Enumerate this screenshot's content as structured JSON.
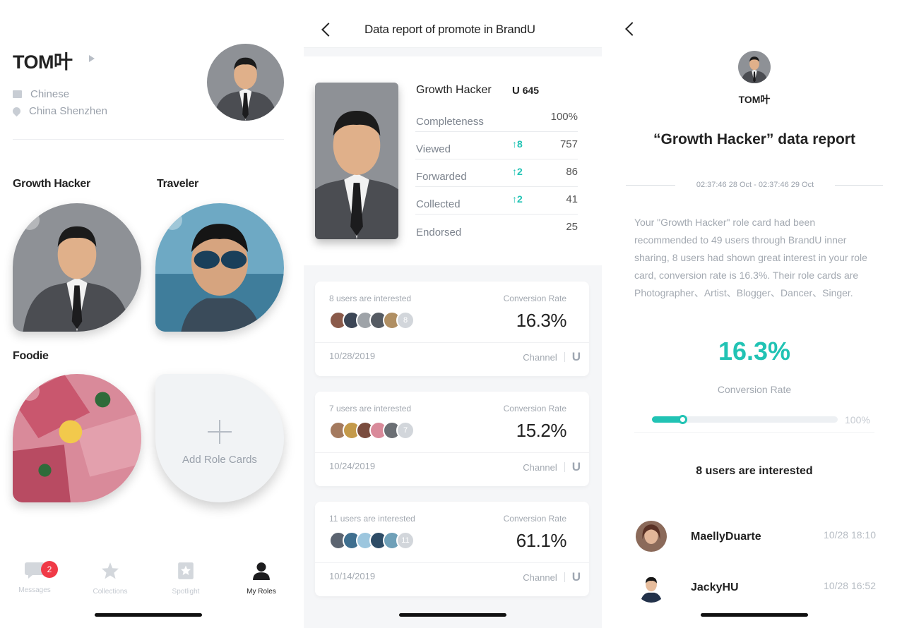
{
  "profile": {
    "name": "TOM叶",
    "language": "Chinese",
    "location": "China Shenzhen"
  },
  "roles": [
    {
      "title": "Growth Hacker",
      "menu": "···"
    },
    {
      "title": "Traveler",
      "menu": "···"
    },
    {
      "title": "Foodie",
      "menu": "···"
    }
  ],
  "add_card_label": "Add Role Cards",
  "tabbar": {
    "messages": "Messages",
    "messages_badge": "2",
    "collections": "Collections",
    "spotlight": "Spotlight",
    "my_roles": "My Roles"
  },
  "report": {
    "header_title": "Data report of promote in BrandU",
    "role": "Growth Hacker",
    "u_score": "645",
    "stats": [
      {
        "label": "Completeness",
        "delta": "",
        "value": "100%"
      },
      {
        "label": "Viewed",
        "delta": "↑8",
        "value": "757"
      },
      {
        "label": "Forwarded",
        "delta": "↑2",
        "value": "86"
      },
      {
        "label": "Collected",
        "delta": "↑2",
        "value": "41"
      },
      {
        "label": "Endorsed",
        "delta": "",
        "value": "25"
      }
    ],
    "conversion_label": "Conversion Rate",
    "channel_label": "Channel",
    "cards": [
      {
        "interest": "8 users are interested",
        "rate": "16.3%",
        "date": "10/28/2019",
        "count": "8"
      },
      {
        "interest": "7 users are interested",
        "rate": "15.2%",
        "date": "10/24/2019",
        "count": "7"
      },
      {
        "interest": "11 users are interested",
        "rate": "61.1%",
        "date": "10/14/2019",
        "count": "11"
      }
    ]
  },
  "detail": {
    "user": "TOM叶",
    "title": "“Growth Hacker” data report",
    "range": "02:37:46 28 Oct - 02:37:46 29 Oct",
    "description": "Your \"Growth Hacker\" role card had been recommended to 49 users through BrandU inner sharing, 8 users had shown great interest in your role card, conversion rate is 16.3%. Their role cards are Photographer、Artist、Blogger、Dancer、Singer.",
    "rate": "16.3%",
    "rate_fraction": 0.163,
    "conversion_label": "Conversion Rate",
    "progress_max": "100%",
    "interested_heading": "8 users are interested",
    "users": [
      {
        "name": "MaellyDuarte",
        "time": "10/28 18:10"
      },
      {
        "name": "JackyHU",
        "time": "10/28 16:52"
      }
    ]
  },
  "colors": {
    "accent": "#21c3b4",
    "badge": "#f03a47"
  }
}
